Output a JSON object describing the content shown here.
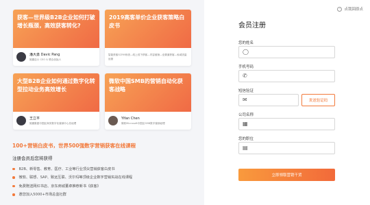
{
  "cards": [
    {
      "title": "获客—世界级B2B企业如何打破增长瓶颈，高效获客转化?",
      "author_name": "潘大勇 Davic Pang",
      "author_desc": "致趣百川 CEO & 联合创始人"
    },
    {
      "title": "2019高客单价企业获客策略白皮书",
      "author_name": "",
      "author_desc": "智能获客SCRM系统—线上线下获客—内容营销—全渠道获客—私域流量运营"
    },
    {
      "title": "大型B2B企业如何通过数字化转型拉动业务高效增长",
      "author_name": "王立平",
      "author_desc": "致趣集团中国区商务数字化营销中心总经理"
    },
    {
      "title": "微软中国SMB的营销自动化获客战略",
      "author_name": "Yifan Chen",
      "author_desc": "微软Microsoft中国区SMB数字营销经理"
    }
  ],
  "section_title": "100+营销白皮书，世界500强数字营销获客在线课程",
  "benefits_title": "注册会员后您将获得",
  "benefits": [
    "B2B、新零售、教育、医疗、工业等行业顶尖营销获客白皮书",
    "微软、联想、SAP、致远互联、沃尔玛等顶级企业数字营销实战在线课程",
    "免费赠送网红书店、京东商城董卓推荐新书《获客》",
    "邀您加入5000+市场总监社群"
  ],
  "back_link": "点我回原点",
  "form": {
    "title": "会员注册",
    "name_label": "您的姓名",
    "phone_label": "手机号码",
    "code_label": "短信验证",
    "code_button": "发送验证码",
    "company_label": "公司名称",
    "position_label": "您的职位",
    "submit_label": "立即领取营销干货"
  },
  "colors": {
    "accent": "#f2793a",
    "card_gradient_start": "#f7a255",
    "card_gradient_end": "#f06a45"
  },
  "icons": [
    "user-icon",
    "phone-icon",
    "mail-icon",
    "building-icon",
    "id-card-icon",
    "back-icon"
  ]
}
